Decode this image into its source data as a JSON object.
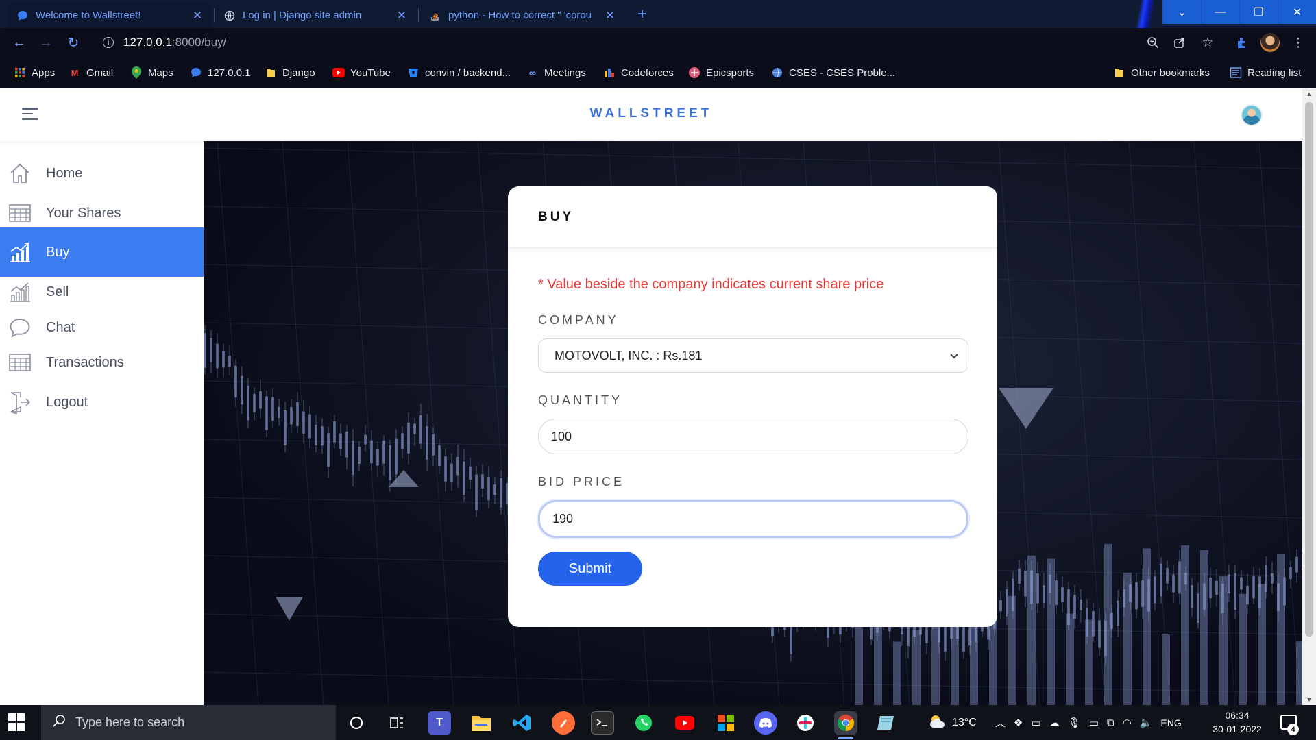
{
  "browser": {
    "tabs": [
      {
        "title": "Welcome to Wallstreet!",
        "icon": "chat-bubble-icon",
        "active": true
      },
      {
        "title": "Log in | Django site admin",
        "icon": "globe-icon",
        "active": false
      },
      {
        "title": "python - How to correct \" 'corou",
        "icon": "stackoverflow-icon",
        "active": false
      }
    ],
    "new_tab_symbol": "+",
    "window_controls": [
      "chevron-down-icon",
      "minimize-icon",
      "restore-icon",
      "close-icon"
    ],
    "url_host": "127.0.0.1",
    "url_path": ":8000/buy/",
    "bookmarks": [
      {
        "label": "Apps",
        "icon": "apps-grid-icon"
      },
      {
        "label": "Gmail",
        "icon": "gmail-icon"
      },
      {
        "label": "Maps",
        "icon": "maps-pin-icon"
      },
      {
        "label": "127.0.0.1",
        "icon": "chat-bubble-icon"
      },
      {
        "label": "Django",
        "icon": "folder-icon"
      },
      {
        "label": "YouTube",
        "icon": "youtube-icon"
      },
      {
        "label": "convin / backend...",
        "icon": "bitbucket-icon"
      },
      {
        "label": "Meetings",
        "icon": "meetings-icon"
      },
      {
        "label": "Codeforces",
        "icon": "codeforces-icon"
      },
      {
        "label": "Epicsports",
        "icon": "epicsports-icon"
      },
      {
        "label": "CSES - CSES Proble...",
        "icon": "globe-icon"
      },
      {
        "label": "Other bookmarks",
        "icon": "folder-icon"
      },
      {
        "label": "Reading list",
        "icon": "reading-list-icon"
      }
    ]
  },
  "app": {
    "brand": "WALLSTREET",
    "sidebar": [
      {
        "label": "Home",
        "icon": "home-icon",
        "active": false
      },
      {
        "label": "Your Shares",
        "icon": "table-icon",
        "active": false
      },
      {
        "label": "Buy",
        "icon": "chart-up-icon",
        "active": true
      },
      {
        "label": "Sell",
        "icon": "chart-down-icon",
        "active": false
      },
      {
        "label": "Chat",
        "icon": "chat-icon",
        "active": false
      },
      {
        "label": "Transactions",
        "icon": "table-icon",
        "active": false
      },
      {
        "label": "Logout",
        "icon": "logout-icon",
        "active": false
      }
    ],
    "form": {
      "title": "BUY",
      "note": "* Value beside the company indicates current share price",
      "company_label": "COMPANY",
      "company_value": "MOTOVOLT, INC. : Rs.181",
      "quantity_label": "QUANTITY",
      "quantity_value": "100",
      "bid_label": "BID PRICE",
      "bid_value": "190",
      "submit_label": "Submit"
    },
    "colors": {
      "accent": "#3b7cf0",
      "brand": "#3a6fd8",
      "warning": "#e53935",
      "button": "#2563eb"
    }
  },
  "taskbar": {
    "search_placeholder": "Type here to search",
    "weather": "13°C",
    "language": "ENG",
    "time": "06:34",
    "date": "30-01-2022",
    "notification_count": "4"
  }
}
